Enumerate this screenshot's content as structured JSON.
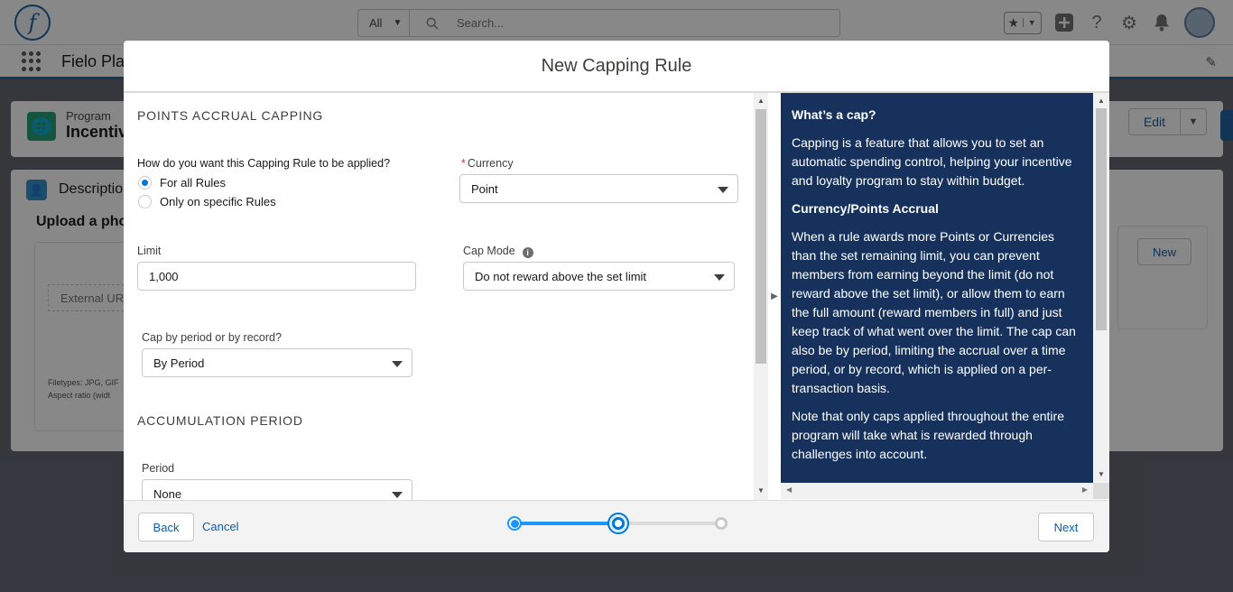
{
  "background": {
    "logo_letter": "f",
    "search_scope": "All",
    "search_placeholder": "Search...",
    "app_name": "Fielo Pla",
    "program_label": "Program",
    "program_title": "Incentiv",
    "edit_label": "Edit",
    "description_label": "Descriptio",
    "upload_title": "Upload a pho",
    "external_url_label": "External UR",
    "filetypes_text": "Filetypes: JPG, GIF",
    "aspect_text": "Aspect ratio (widt",
    "new_label": "New"
  },
  "modal": {
    "title": "New Capping Rule",
    "section1_title": "POINTS ACCRUAL CAPPING",
    "apply_question": "How do you want this Capping Rule to be applied?",
    "apply_options": [
      {
        "label": "For all Rules",
        "checked": true
      },
      {
        "label": "Only on specific Rules",
        "checked": false
      }
    ],
    "currency_required": "*",
    "currency_label": "Currency",
    "currency_value": "Point",
    "limit_label": "Limit",
    "limit_value": "1,000",
    "cap_mode_label": "Cap Mode",
    "cap_mode_value": "Do not reward above the set limit",
    "cap_by_label": "Cap by period or by record?",
    "cap_by_value": "By Period",
    "section2_title": "ACCUMULATION PERIOD",
    "period_label": "Period",
    "period_value": "None"
  },
  "help": {
    "heading1": "What’s a cap?",
    "para1": "Capping is a feature that allows you to set an automatic spending control, helping your incentive and loyalty program to stay within budget.",
    "heading2": "Currency/Points Accrual",
    "para2": "When a rule awards more Points or Currencies than the set remaining limit, you can prevent members from earning beyond the limit (do not reward above the set limit), or allow them to earn the full amount (reward members in full) and just keep track of what went over the limit. The cap can also be by period, limiting the accrual over a time period, or by record, which is applied on a per-transaction basis.",
    "para3": "Note that only caps applied throughout the entire program will take what is rewarded through challenges into account."
  },
  "footer": {
    "back_label": "Back",
    "cancel_label": "Cancel",
    "next_label": "Next",
    "current_step": 2,
    "total_steps": 3
  },
  "colors": {
    "brand": "#0176d3",
    "help_bg": "#16325c",
    "link": "#0b5cab",
    "required": "#c23934"
  }
}
